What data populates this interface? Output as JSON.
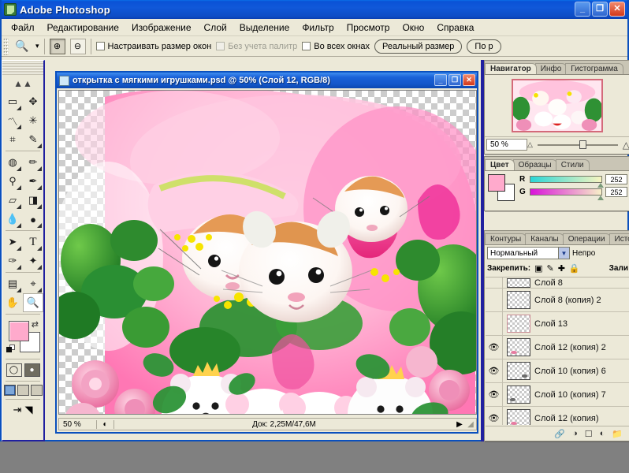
{
  "app": {
    "title": "Adobe Photoshop",
    "icon": "photoshop-logo-icon",
    "window_buttons": {
      "minimize": "_",
      "restore": "❐",
      "close": "✕"
    }
  },
  "menubar": {
    "items": [
      {
        "label": "Файл"
      },
      {
        "label": "Редактирование"
      },
      {
        "label": "Изображение"
      },
      {
        "label": "Слой"
      },
      {
        "label": "Выделение"
      },
      {
        "label": "Фильтр"
      },
      {
        "label": "Просмотр"
      },
      {
        "label": "Окно"
      },
      {
        "label": "Справка"
      }
    ]
  },
  "options_bar": {
    "tool_icon": "zoom-tool-icon",
    "tool_dropdown": "▾",
    "zoom_in_icon": "zoom-in-icon",
    "zoom_out_icon": "zoom-out-icon",
    "checkbox_resize_windows": {
      "label": "Настраивать размер окон",
      "checked": false
    },
    "checkbox_ignore_palettes": {
      "label": "Без учета палитр",
      "checked": false,
      "disabled": true
    },
    "checkbox_all_windows": {
      "label": "Во всех окнах",
      "checked": false
    },
    "button_actual_size": "Реальный размер",
    "button_fit": "По р"
  },
  "toolbox": {
    "tools": [
      {
        "name": "marquee-tool",
        "glyph": "▭"
      },
      {
        "name": "move-tool",
        "glyph": "✥"
      },
      {
        "name": "lasso-tool",
        "glyph": "〽"
      },
      {
        "name": "magic-wand-tool",
        "glyph": "✳"
      },
      {
        "name": "crop-tool",
        "glyph": "⌗"
      },
      {
        "name": "slice-tool",
        "glyph": "✎"
      },
      {
        "name": "healing-brush-tool",
        "glyph": "◍"
      },
      {
        "name": "brush-tool",
        "glyph": "✏"
      },
      {
        "name": "clone-stamp-tool",
        "glyph": "⚲"
      },
      {
        "name": "history-brush-tool",
        "glyph": "✒"
      },
      {
        "name": "eraser-tool",
        "glyph": "▱"
      },
      {
        "name": "gradient-tool",
        "glyph": "◨"
      },
      {
        "name": "blur-tool",
        "glyph": "💧"
      },
      {
        "name": "dodge-tool",
        "glyph": "●"
      },
      {
        "name": "path-selection-tool",
        "glyph": "➤"
      },
      {
        "name": "type-tool",
        "glyph": "T"
      },
      {
        "name": "pen-tool",
        "glyph": "✑"
      },
      {
        "name": "shape-tool",
        "glyph": "✦"
      },
      {
        "name": "notes-tool",
        "glyph": "▤"
      },
      {
        "name": "eyedropper-tool",
        "glyph": "⌖"
      },
      {
        "name": "hand-tool",
        "glyph": "✋"
      },
      {
        "name": "zoom-tool",
        "glyph": "🔍"
      }
    ],
    "colors": {
      "foreground": "#ffaacc",
      "background": "#ffffff",
      "swap_icon": "swap-colors-icon",
      "reset_icon": "default-colors-icon"
    },
    "quick_mask": [
      "standard-mode-icon",
      "quick-mask-mode-icon"
    ],
    "screen_modes": [
      "standard-screen-icon",
      "full-screen-menubar-icon",
      "full-screen-icon"
    ],
    "jump_to": [
      "jump-to-imageready-icon",
      "jump-to-icon"
    ]
  },
  "document": {
    "title": "открытка с мягкими игрушками.psd @ 50% (Слой 12, RGB/8)",
    "icon": "document-icon",
    "window_buttons": {
      "minimize": "_",
      "maximize": "❐",
      "close": "✕"
    },
    "status": {
      "zoom": "50 %",
      "preview_icon": "preview-icon",
      "doc_size": "Док: 2,25M/47,6M",
      "arrow": "▶",
      "resize_grip": "resize-grip-icon"
    }
  },
  "navigator_panel": {
    "tabs": [
      {
        "label": "Навигатор",
        "active": true
      },
      {
        "label": "Инфо",
        "active": false
      },
      {
        "label": "Гистограмма",
        "active": false
      }
    ],
    "zoom_value": "50 %",
    "zoom_out_icon": "small-mountain-icon",
    "zoom_in_icon": "large-mountain-icon",
    "thumb_border_color": "#d46a7a"
  },
  "color_panel": {
    "tabs": [
      {
        "label": "Цвет",
        "active": true
      },
      {
        "label": "Образцы",
        "active": false
      },
      {
        "label": "Стили",
        "active": false
      }
    ],
    "foreground": "#ffaacc",
    "background": "#ffffff",
    "channels": [
      {
        "label": "R",
        "value": "252"
      },
      {
        "label": "G",
        "value": "252"
      }
    ]
  },
  "layers_panel": {
    "tabs": [
      {
        "label": "Контуры",
        "active": false
      },
      {
        "label": "Каналы",
        "active": false
      },
      {
        "label": "Операции",
        "active": false
      },
      {
        "label": "Истор",
        "active": false
      }
    ],
    "blend_mode": "Нормальный",
    "blend_dropdown_icon": "chevron-down-icon",
    "opacity_label": "Непро",
    "lock_label": "Закрепить:",
    "lock_icons": [
      "lock-transparency-icon",
      "lock-image-icon",
      "lock-position-icon",
      "lock-all-icon"
    ],
    "fill_label": "Зали",
    "layers": [
      {
        "name": "Слой 8",
        "visible": false,
        "partial": true,
        "thumb": "transparent"
      },
      {
        "name": "Слой 8 (копия) 2",
        "visible": false,
        "thumb": "transparent"
      },
      {
        "name": "Слой 13",
        "visible": false,
        "thumb": "pink-border"
      },
      {
        "name": "Слой 12 (копия) 2",
        "visible": true,
        "thumb": "transparent-blob"
      },
      {
        "name": "Слой 10 (копия) 6",
        "visible": true,
        "thumb": "transparent-dark"
      },
      {
        "name": "Слой 10 (копия) 7",
        "visible": true,
        "thumb": "transparent-dark"
      },
      {
        "name": "Слой 12 (копия)",
        "visible": true,
        "thumb": "transparent-blob"
      }
    ],
    "footer_icons": [
      "link-layers-icon",
      "layer-style-icon",
      "layer-mask-icon",
      "adjustment-layer-icon",
      "new-group-icon"
    ]
  }
}
